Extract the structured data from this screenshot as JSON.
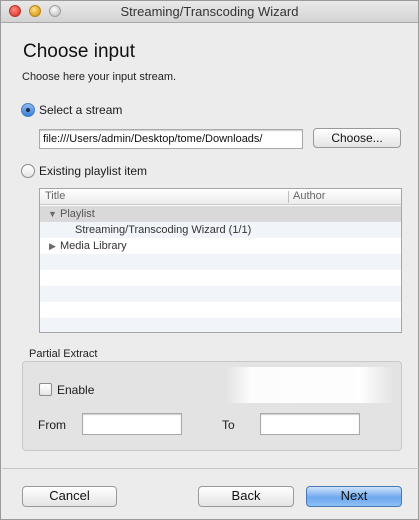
{
  "window": {
    "title": "Streaming/Transcoding Wizard"
  },
  "page": {
    "heading": "Choose input",
    "subheading": "Choose here your input stream."
  },
  "stream_option": {
    "label": "Select a stream",
    "selected": true,
    "path_value": "file:///Users/admin/Desktop/tome/Downloads/",
    "choose_button": "Choose..."
  },
  "playlist_option": {
    "label": "Existing playlist item",
    "selected": false
  },
  "playlist": {
    "columns": [
      "Title",
      "Author"
    ],
    "rows": [
      {
        "label": "Playlist",
        "expanded": true,
        "selected": true
      },
      {
        "label": "Streaming/Transcoding Wizard (1/1)",
        "expanded": null,
        "selected": false
      },
      {
        "label": "Media Library",
        "expanded": false,
        "selected": false
      }
    ]
  },
  "partial_extract": {
    "group_label": "Partial Extract",
    "enable_label": "Enable",
    "enable_checked": false,
    "from_label": "From",
    "from_value": "",
    "to_label": "To",
    "to_value": ""
  },
  "footer": {
    "cancel": "Cancel",
    "back": "Back",
    "next": "Next"
  },
  "icons": {
    "expanded": "▼",
    "collapsed": "▶"
  }
}
